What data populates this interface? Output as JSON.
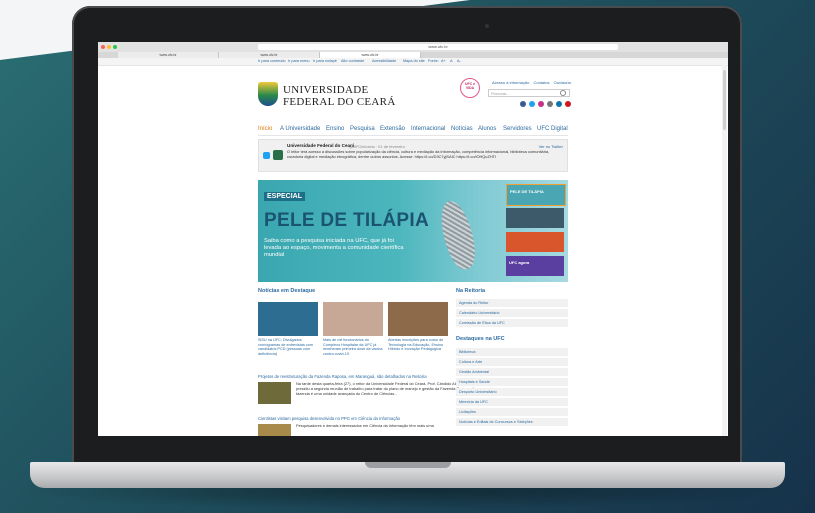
{
  "browser": {
    "url": "www.ufc.br",
    "tabs": [
      "www.ufc.br",
      "www.ufc.br",
      "www.ufc.br"
    ]
  },
  "accessibility_bar": {
    "items": [
      "Ir para conteúdo",
      "Ir para menu",
      "Ir para rodapé",
      "Alto contraste",
      "Acessibilidade",
      "Mapa do site",
      "Fonte:",
      "A+",
      "A",
      "A-"
    ]
  },
  "header": {
    "logo_line1": "UNIVERSIDADE",
    "logo_line2": "FEDERAL DO CEARÁ",
    "badge": "UFC é VIDA",
    "top_links": [
      "Acesso à informação",
      "Contatos",
      "Ouvidoria"
    ],
    "search_placeholder": "Procurar..."
  },
  "nav": {
    "items": [
      "Início",
      "A Universidade",
      "Ensino",
      "Pesquisa",
      "Extensão",
      "Internacional",
      "Notícias",
      "Alunos",
      "Servidores",
      "UFC Digital"
    ],
    "active": "Início"
  },
  "tweet": {
    "name": "Universidade Federal do Ceará",
    "handle": "@UFCinforma · 01 de fevereiro",
    "link": "Ver no Twitter",
    "text": "O leitor terá acesso a discussões sobre popularização da ciência, cultura e mediação da informação, competência informacional, biblioteca comunitária, curadoria digital e mediação etnográfica, dentre outros assuntos. Acesse: https://t.co/D3C7yjSAIC https://t.co/iOHQuZHTI"
  },
  "banner": {
    "tag": "ESPECIAL",
    "title": "PELE DE TILÁPIA",
    "subtitle": "Saiba como a pesquisa iniciada na UFC, que já foi levada ao espaço, movimenta a comunidade científica mundial",
    "thumbs": [
      "PELE DE TILÁPIA",
      "",
      "",
      "UFC agora"
    ]
  },
  "news_section": {
    "title": "Notícias em Destaque",
    "items": [
      {
        "text": "SiSU na UFC: Divulgados cronogramas de entrevistas com candidatos PCD (pessoas com deficiência)"
      },
      {
        "text": "Mais de mil funcionários do Complexo Hospitalar da UFC já receberam primeira dose da vacina contra covid-19"
      },
      {
        "text": "Abertas inscrições para curso de Tecnologia na Educação, Ensino Híbrido e Inovação Pedagógica"
      }
    ],
    "articles": [
      {
        "title": "Projetos de reestruturação da Fazenda Raposa, em Maranguá, são detalhados na Reitoria",
        "text": "Na tarde desta quarta-feira (27), o reitor da Universidade Federal do Ceará, Prof. Cândido Albuquerque, presidiu a segunda reunião de trabalho para tratar do plano de manejo e gestão da Fazenda Raposa. A fazenda é uma unidade avançada do Centro de Ciências..."
      },
      {
        "title": "Cientistas visitam pesquisa desenvolvida no PPG em Ciência da Informação",
        "text": "Pesquisadores e demais interessados em Ciência da Informação têm mais uma"
      }
    ]
  },
  "sidebar": {
    "reitoria_title": "Na Reitoria",
    "reitoria_items": [
      "Agenda do Reitor",
      "Calendário Universitário",
      "Comissão de Ética da UFC"
    ],
    "destaques_title": "Destaques na UFC",
    "destaques_items": [
      "Biblioteca",
      "Cultura e Arte",
      "Gestão Ambiental",
      "Hospitais e Saúde",
      "Desporto Universitário",
      "Memória da UFC",
      "Licitações",
      "Notícias e Editais de Concursos e Seleções"
    ]
  },
  "colors": {
    "link": "#2c6aa0",
    "active_nav": "#e07a14",
    "banner_title": "#1a5470"
  }
}
